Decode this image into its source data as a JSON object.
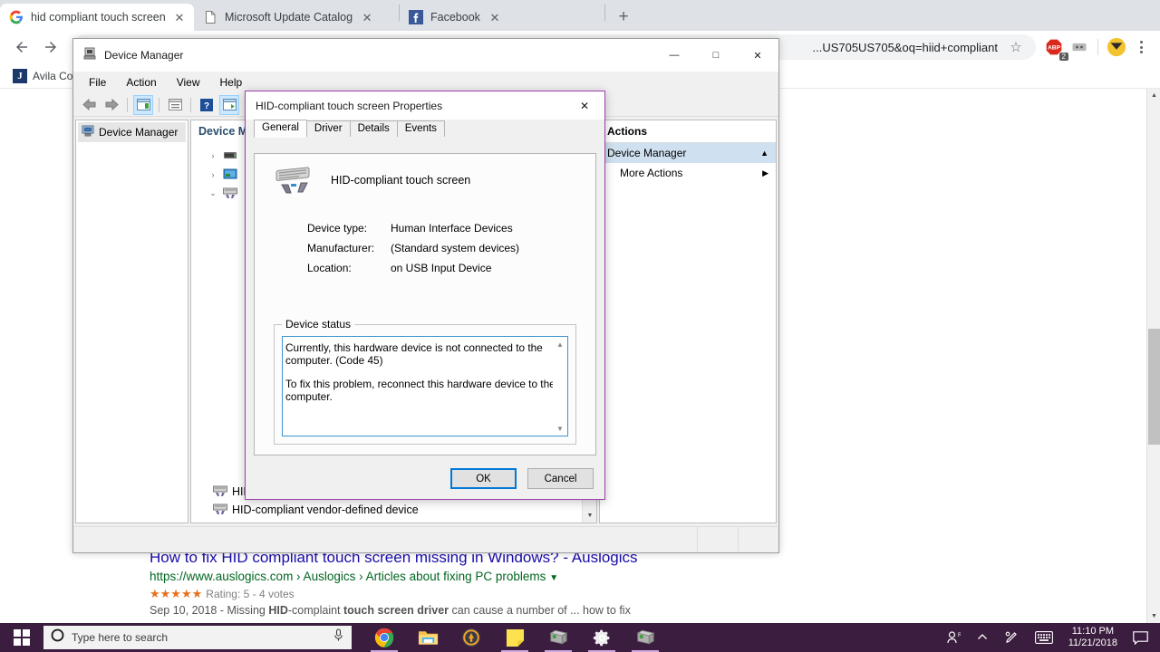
{
  "browser": {
    "tabs": [
      {
        "title": "hid compliant touch screen drive",
        "favicon": "google-icon",
        "active": true
      },
      {
        "title": "Microsoft Update Catalog",
        "favicon": "page-icon",
        "active": false
      },
      {
        "title": "Facebook",
        "favicon": "facebook-icon",
        "active": false
      }
    ],
    "new_tab_label": "+",
    "back_label": "Back",
    "forward_label": "Forward",
    "omnibox_text": "US705US705&oq=hiid+compliant...",
    "bookmark": {
      "label": "Avila Co",
      "icon_letter": "J"
    },
    "extension_badge": "2"
  },
  "search_result": {
    "title": "How to fix HID compliant touch screen missing in Windows? - Auslogics",
    "url": "https://www.auslogics.com › Auslogics › Articles about fixing PC problems",
    "stars": "★★★★★",
    "rating": "Rating: 5 - 4 votes",
    "snippet_date": "Sep 10, 2018 - ",
    "snippet_1": "Missing ",
    "snippet_b1": "HID",
    "snippet_2": "-complaint ",
    "snippet_b2": "touch screen driver",
    "snippet_3": " can cause a number of ...   how to fix"
  },
  "device_manager": {
    "title": "Device Manager",
    "menus": [
      "File",
      "Action",
      "View",
      "Help"
    ],
    "toolbar_icons": [
      "back-arrow-icon",
      "forward-arrow-icon",
      "show-hidden-icon",
      "properties-icon",
      "help-icon",
      "update-driver-icon",
      "scan-hardware-icon"
    ],
    "window_buttons": {
      "minimize": "—",
      "maximize": "□",
      "close": "✕"
    },
    "left_pane": {
      "item": "Device Manager"
    },
    "center_header": "Device M",
    "tree_rows": [
      {
        "chevron": "›",
        "icon": "disk-drive-icon",
        "label": ""
      },
      {
        "chevron": "›",
        "icon": "display-adapter-icon",
        "label": ""
      },
      {
        "chevron": "⌄",
        "icon": "hid-device-icon",
        "label": ""
      }
    ],
    "bottom_devices": [
      "HID-compliant vendor-defined device",
      "HID-compliant vendor-defined device"
    ],
    "actions_pane": {
      "header": "Actions",
      "row1": "Device Manager",
      "row1_caret": "▲",
      "row2": "More Actions",
      "row2_caret": "▶"
    }
  },
  "properties_dialog": {
    "title": "HID-compliant touch screen Properties",
    "close_label": "✕",
    "tabs": [
      {
        "label": "General",
        "active": true
      },
      {
        "label": "Driver",
        "active": false
      },
      {
        "label": "Details",
        "active": false
      },
      {
        "label": "Events",
        "active": false
      }
    ],
    "device_name": "HID-compliant touch screen",
    "fields": [
      {
        "label": "Device type:",
        "value": "Human Interface Devices"
      },
      {
        "label": "Manufacturer:",
        "value": "(Standard system devices)"
      },
      {
        "label": "Location:",
        "value": "on USB Input Device"
      }
    ],
    "status_group_label": "Device status",
    "status_paragraph_1": "Currently, this hardware device is not connected to the computer. (Code 45)",
    "status_paragraph_2": "To fix this problem, reconnect this hardware device to the computer.",
    "buttons": {
      "ok": "OK",
      "cancel": "Cancel"
    }
  },
  "taskbar": {
    "start_label": "Start",
    "search_placeholder": "Type here to search",
    "search_icon": "cortana-circle-icon",
    "mic_icon": "microphone-icon",
    "apps": [
      {
        "name": "chrome-icon",
        "open": true
      },
      {
        "name": "file-explorer-icon",
        "open": false
      },
      {
        "name": "overwatch-icon",
        "open": false
      },
      {
        "name": "sticky-notes-icon",
        "open": true
      },
      {
        "name": "device-manager-icon",
        "open": true
      },
      {
        "name": "settings-icon",
        "open": true
      },
      {
        "name": "device-manager-icon-2",
        "open": true
      }
    ],
    "tray": [
      "people-icon",
      "show-hidden-icons-chevron",
      "pen-icon",
      "touch-keyboard-icon"
    ],
    "time": "11:10 PM",
    "date": "11/21/2018",
    "action_center_icon": "notification-icon"
  },
  "colors": {
    "taskbar_bg": "#3b1e3f",
    "dialog_border": "#9b3ea8",
    "accent_blue": "#0078d7",
    "link_blue": "#1a0dab",
    "url_green": "#006621",
    "star_orange": "#e7711b"
  }
}
